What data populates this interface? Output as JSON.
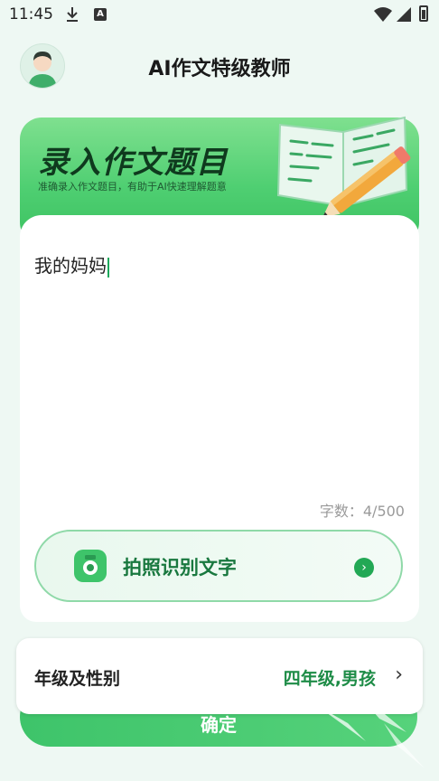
{
  "status_bar": {
    "time": "11:45"
  },
  "header": {
    "title": "AI作文特级教师"
  },
  "topic_card": {
    "title": "录入作文题目",
    "subtitle": "准确录入作文题目，有助于AI快速理解题意"
  },
  "editor": {
    "value": "我的妈妈",
    "word_count": "字数：4/500"
  },
  "ocr_button": {
    "label": "拍照识别文字"
  },
  "confirm_button": {
    "label": "确定"
  },
  "grade_panel": {
    "label": "年级及性别",
    "value": "四年级,男孩"
  },
  "colors": {
    "accent": "#3ec46a",
    "accent_dark": "#1e8c47",
    "background": "#eef8f3"
  }
}
